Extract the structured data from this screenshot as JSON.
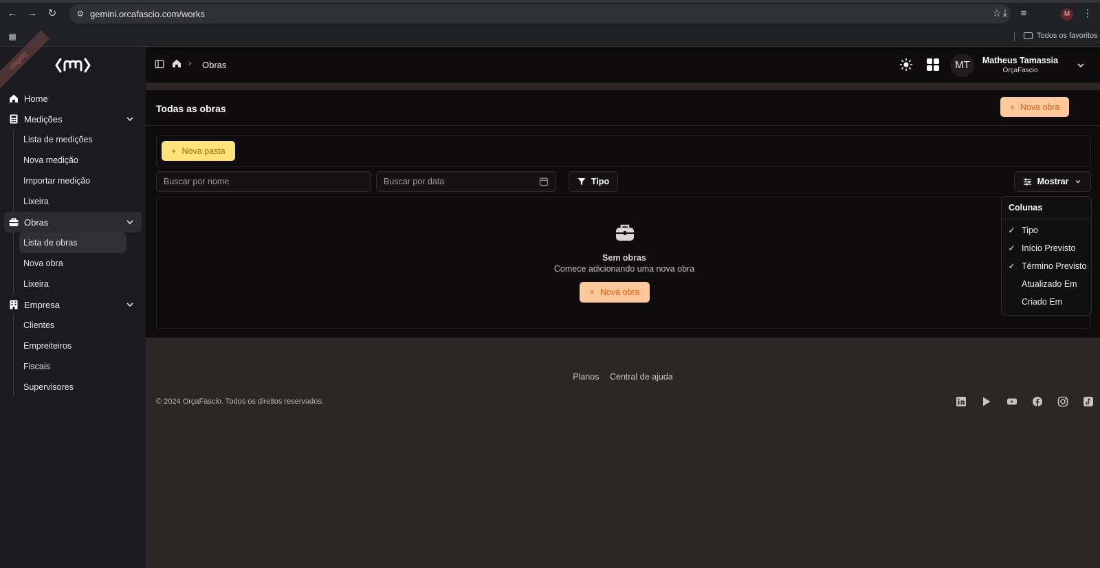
{
  "browser": {
    "url": "gemini.orcafascio.com/works",
    "profile_initial": "M",
    "bookmarks_label": "Todos os favoritos"
  },
  "sidebar": {
    "staging_label": "staging",
    "items": [
      {
        "label": "Home"
      },
      {
        "label": "Medições",
        "children": [
          "Lista de medições",
          "Nova medição",
          "Importar medição",
          "Lixeira"
        ]
      },
      {
        "label": "Obras",
        "children": [
          "Lista de obras",
          "Nova obra",
          "Lixeira"
        ]
      },
      {
        "label": "Empresa",
        "children": [
          "Clientes",
          "Empreiteiros",
          "Fiscais",
          "Supervisores"
        ]
      }
    ]
  },
  "topbar": {
    "breadcrumb": "Obras",
    "avatar_initials": "MT",
    "user_name": "Matheus Tamassia",
    "user_org": "OrçaFascio"
  },
  "main": {
    "title": "Todas as obras",
    "new_work_button": "Nova obra",
    "new_folder_button": "Nova pasta",
    "search_name_placeholder": "Buscar por nome",
    "search_date_placeholder": "Buscar por data",
    "type_filter_label": "Tipo",
    "show_button": "Mostrar",
    "empty_title": "Sem obras",
    "empty_subtitle": "Comece adicionando uma nova obra",
    "empty_button": "Nova obra"
  },
  "columns_menu": {
    "title": "Colunas",
    "items": [
      {
        "label": "Tipo",
        "checked": true
      },
      {
        "label": "Início Previsto",
        "checked": true
      },
      {
        "label": "Término Previsto",
        "checked": true
      },
      {
        "label": "Atualizado Em",
        "checked": false
      },
      {
        "label": "Criado Em",
        "checked": false
      }
    ]
  },
  "footer": {
    "links": [
      "Planos",
      "Central de ajuda"
    ],
    "copyright": "© 2024 OrçaFascio. Todos os direitos reservados.",
    "social_icons": [
      "linkedin-icon",
      "play-icon",
      "youtube-icon",
      "facebook-icon",
      "instagram-icon",
      "tiktok-icon"
    ]
  },
  "colors": {
    "accent_orange_bg": "#fdc99a",
    "accent_orange_text": "#e45f14",
    "accent_yellow_bg": "#fde37a"
  }
}
